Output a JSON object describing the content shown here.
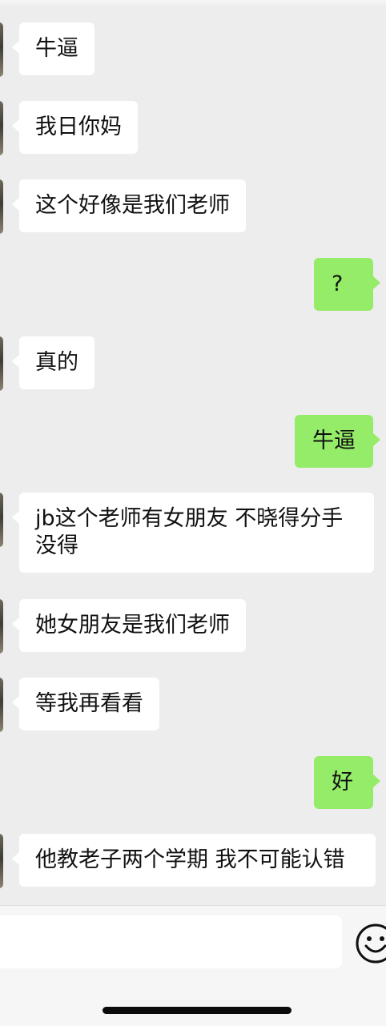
{
  "messages": [
    {
      "side": "in",
      "text": "牛逼"
    },
    {
      "side": "in",
      "text": "我日你妈"
    },
    {
      "side": "in",
      "text": "这个好像是我们老师"
    },
    {
      "side": "out",
      "text": "?"
    },
    {
      "side": "in",
      "text": "真的"
    },
    {
      "side": "out",
      "text": "牛逼"
    },
    {
      "side": "in",
      "text": "jb这个老师有女朋友 不晓得分手\n没得"
    },
    {
      "side": "in",
      "text": "她女朋友是我们老师"
    },
    {
      "side": "in",
      "text": "等我再看看"
    },
    {
      "side": "out",
      "text": "好"
    },
    {
      "side": "in",
      "text": "他教老子两个学期 我不可能认错"
    }
  ],
  "input_bar": {
    "emoji_icon": "smiley-face-icon"
  }
}
